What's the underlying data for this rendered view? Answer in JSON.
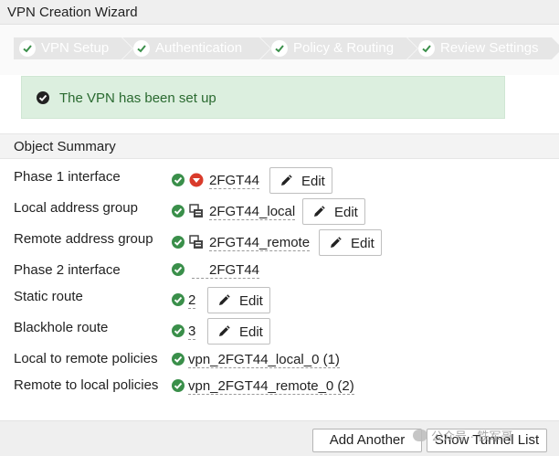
{
  "window": {
    "title": "VPN Creation Wizard"
  },
  "wizard": {
    "steps": [
      {
        "label": "VPN Setup",
        "state": "done"
      },
      {
        "label": "Authentication",
        "state": "done"
      },
      {
        "label": "Policy & Routing",
        "state": "done"
      },
      {
        "label": "Review Settings",
        "state": "current"
      }
    ]
  },
  "banner": {
    "message": "The VPN has been set up",
    "icon": "check-circle-icon"
  },
  "summary": {
    "header": "Object Summary",
    "rows": [
      {
        "label": "Phase 1 interface",
        "status": "success",
        "icon": "tunnel-down-icon",
        "value": "2FGT44",
        "action": "Edit"
      },
      {
        "label": "Local address group",
        "status": "success",
        "icon": "address-group-icon",
        "value": "2FGT44_local",
        "action": "Edit"
      },
      {
        "label": "Remote address group",
        "status": "success",
        "icon": "address-group-icon",
        "value": "2FGT44_remote",
        "action": "Edit"
      },
      {
        "label": "Phase 2 interface",
        "status": "success",
        "icon": "",
        "value": "2FGT44",
        "action": ""
      },
      {
        "label": "Static route",
        "status": "success",
        "icon": "",
        "value": "2",
        "action": "Edit"
      },
      {
        "label": "Blackhole route",
        "status": "success",
        "icon": "",
        "value": "3",
        "action": "Edit"
      },
      {
        "label": "Local to remote policies",
        "status": "success",
        "icon": "",
        "value": "vpn_2FGT44_local_0 (1)",
        "action": ""
      },
      {
        "label": "Remote to local policies",
        "status": "success",
        "icon": "",
        "value": "vpn_2FGT44_remote_0 (2)",
        "action": ""
      }
    ]
  },
  "footer": {
    "add_another": "Add Another",
    "show_tunnel_list": "Show Tunnel List",
    "watermark": "公众号 · 铁军哥"
  },
  "colors": {
    "success": "#3a8f4a",
    "banner_bg": "#dcefdf",
    "step_done_bg": "#e6e6e6",
    "tunnel_down": "#d93b2b"
  }
}
